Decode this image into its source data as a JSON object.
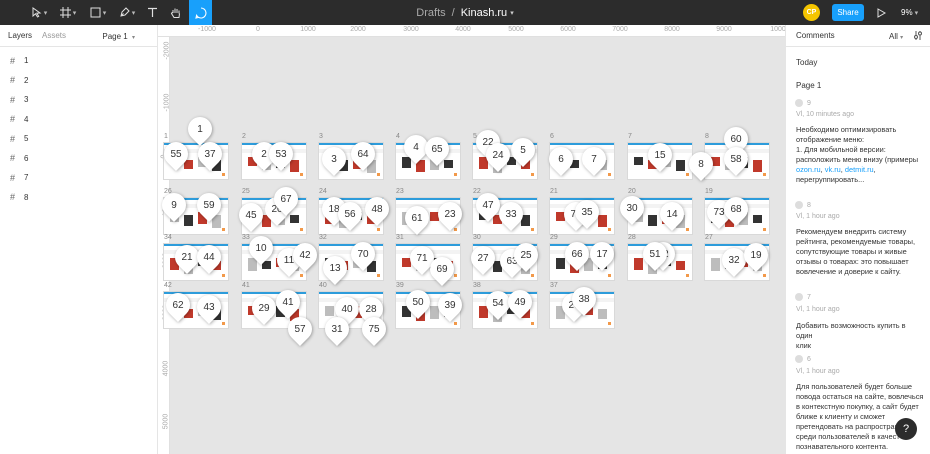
{
  "toolbar": {
    "tools": [
      {
        "name": "move-tool",
        "icon": "cursor-icon",
        "caret": true
      },
      {
        "name": "frame-tool",
        "icon": "frame-icon",
        "caret": true
      },
      {
        "name": "shape-tool",
        "icon": "rectangle-icon",
        "caret": true
      },
      {
        "name": "pen-tool",
        "icon": "pen-icon",
        "caret": true
      },
      {
        "name": "text-tool",
        "icon": "text-icon",
        "caret": false
      },
      {
        "name": "hand-tool",
        "icon": "hand-icon",
        "caret": false
      },
      {
        "name": "comment-tool",
        "icon": "comment-icon",
        "caret": false,
        "active": true
      }
    ],
    "breadcrumb_root": "Drafts",
    "breadcrumb_sep": "/",
    "file_name": "Kinash.ru",
    "avatar_initials": "СР",
    "share_label": "Share",
    "zoom": "9%",
    "accent": "#18a0fb"
  },
  "left_panel": {
    "tabs": [
      "Layers",
      "Assets"
    ],
    "page_selector": "Page 1",
    "layers": [
      "1",
      "2",
      "3",
      "4",
      "5",
      "6",
      "7",
      "8"
    ]
  },
  "canvas": {
    "ruler_x": [
      "-1000",
      "0",
      "1000",
      "2000",
      "3000",
      "4000",
      "5000",
      "6000",
      "7000",
      "8000",
      "9000",
      "1000"
    ],
    "ruler_y": [
      "-2000",
      "-1000",
      "0",
      "1000",
      "2000",
      "3000",
      "4000",
      "5000"
    ],
    "frames": [
      {
        "label": "1"
      },
      {
        "label": "2"
      },
      {
        "label": "3"
      },
      {
        "label": "4"
      },
      {
        "label": "5"
      },
      {
        "label": "6"
      },
      {
        "label": "7"
      },
      {
        "label": "8"
      },
      {
        "label": "26"
      },
      {
        "label": "25"
      },
      {
        "label": "24"
      },
      {
        "label": "23"
      },
      {
        "label": "22"
      },
      {
        "label": "21"
      },
      {
        "label": "20"
      },
      {
        "label": "19"
      },
      {
        "label": "34"
      },
      {
        "label": "33"
      },
      {
        "label": "32"
      },
      {
        "label": "31"
      },
      {
        "label": "30"
      },
      {
        "label": "29"
      },
      {
        "label": "28"
      },
      {
        "label": "27"
      },
      {
        "label": "42"
      },
      {
        "label": "41"
      },
      {
        "label": "40"
      },
      {
        "label": "39"
      },
      {
        "label": "38"
      },
      {
        "label": "37"
      }
    ],
    "pins": [
      "1",
      "55",
      "37",
      "2",
      "53",
      "3",
      "64",
      "4",
      "65",
      "22",
      "5",
      "24",
      "6",
      "7",
      "15",
      "8",
      "60",
      "58",
      "9",
      "59",
      "45",
      "20",
      "67",
      "18",
      "56",
      "48",
      "61",
      "23",
      "47",
      "33",
      "74",
      "35",
      "30",
      "14",
      "73",
      "68",
      "21",
      "44",
      "10",
      "11",
      "42",
      "70",
      "13",
      "71",
      "69",
      "27",
      "63",
      "25",
      "66",
      "17",
      "72",
      "51",
      "32",
      "19",
      "62",
      "43",
      "29",
      "41",
      "40",
      "28",
      "50",
      "39",
      "54",
      "49",
      "26",
      "38",
      "57",
      "31",
      "75"
    ]
  },
  "comments_panel": {
    "title": "Comments",
    "filter": "All",
    "section_today": "Today",
    "section_page": "Page 1",
    "comments": [
      {
        "num": "9",
        "time": "Vl, 10 minutes ago",
        "lines": [
          "Необходимо оптимизировать",
          "отображение меню:",
          "1. Для мобильной версии:",
          "расположить меню внизу (примеры"
        ],
        "links": [
          "ozon.ru",
          "vk.ru",
          "detmit.ru"
        ],
        "links_sep": ", ",
        "links_tail": ",",
        "last_line": "перегруппировать..."
      },
      {
        "num": "8",
        "time": "Vl, 1 hour ago",
        "lines": [
          "Рекомендуем внедрить систему",
          "рейтинга, рекомендуемые товары,",
          "сопутствующие товары и живые",
          "отзывы о товарах: это повышает",
          "вовлечение и доверие к сайту."
        ]
      },
      {
        "num": "7",
        "time": "Vl, 1 hour ago",
        "lines": [
          "Добавить возможность купить в один",
          "клик"
        ]
      },
      {
        "num": "6",
        "time": "Vl, 1 hour ago",
        "lines": [
          "Для пользователей будет больше",
          "повода остаться на сайте, вовлечься",
          "в контекстную покупку, а сайт будет",
          "ближе к клиенту и сможет",
          "претендовать на распростран",
          "среди пользователей в качест",
          "познавательного контента."
        ]
      }
    ],
    "help_label": "?"
  }
}
